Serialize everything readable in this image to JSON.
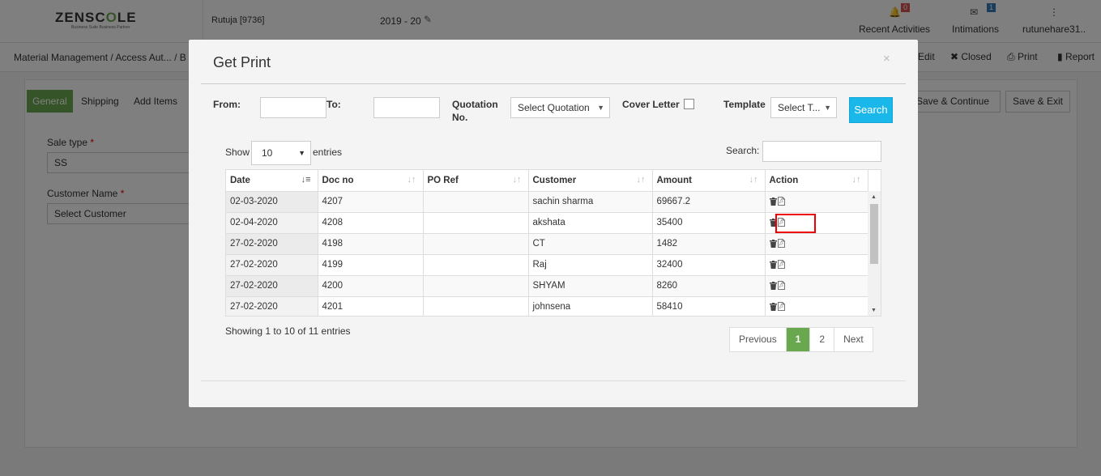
{
  "app": {
    "logo_text_a": "ZENSC",
    "logo_text_accent": "O",
    "logo_text_b": "LE",
    "logo_tagline": "Business Suite Business Partner",
    "user_id": "Rutuja [9736]",
    "financial_year": "2019 - 20",
    "recent_activities_label": "Recent Activities",
    "recent_activities_count": "0",
    "intimations_label": "Intimations",
    "intimations_count": "1",
    "username": "rutunehare31.."
  },
  "breadcrumb": "Material Management  / Access Aut... / B",
  "actions": {
    "edit": "Edit",
    "closed": "Closed",
    "print": "Print",
    "report": "Report"
  },
  "form_bg": {
    "tabs": [
      "General",
      "Shipping",
      "Add Items"
    ],
    "sale_type_label": "Sale type",
    "sale_type_value": "SS",
    "customer_name_label": "Customer Name",
    "customer_name_value": "Select Customer",
    "save_continue_label": "Save & Continue",
    "save_exit_label": "Save & Exit"
  },
  "modal": {
    "title": "Get Print",
    "close_icon": "×",
    "filters": {
      "from_label": "From:",
      "to_label": "To:",
      "quotation_label_1": "Quotation",
      "quotation_label_2": "No.",
      "quotation_value": "Select Quotation",
      "cover_letter_label": "Cover Letter",
      "template_label": "Template",
      "template_value": "Select T...",
      "search_button": "Search"
    },
    "length": {
      "show_label": "Show",
      "value": "10",
      "entries_label": "entries"
    },
    "search_label": "Search:",
    "table": {
      "columns": [
        "Date",
        "Doc no",
        "PO Ref",
        "Customer",
        "Amount",
        "Action"
      ],
      "rows": [
        [
          "02-03-2020",
          "4207",
          "",
          "sachin sharma",
          "69667.2"
        ],
        [
          "02-04-2020",
          "4208",
          "",
          "akshata",
          "35400"
        ],
        [
          "27-02-2020",
          "4198",
          "",
          "CT",
          "1482"
        ],
        [
          "27-02-2020",
          "4199",
          "",
          "Raj",
          "32400"
        ],
        [
          "27-02-2020",
          "4200",
          "",
          "SHYAM",
          "8260"
        ],
        [
          "27-02-2020",
          "4201",
          "",
          "johnsena",
          "58410"
        ]
      ]
    },
    "info": "Showing 1 to 10 of 11 entries",
    "pagination": {
      "previous": "Previous",
      "pages": [
        "1",
        "2"
      ],
      "next": "Next"
    }
  },
  "colors": {
    "accent_green": "#6aa84f",
    "search_blue": "#1ab7ea",
    "highlight_red": "#e00000"
  }
}
